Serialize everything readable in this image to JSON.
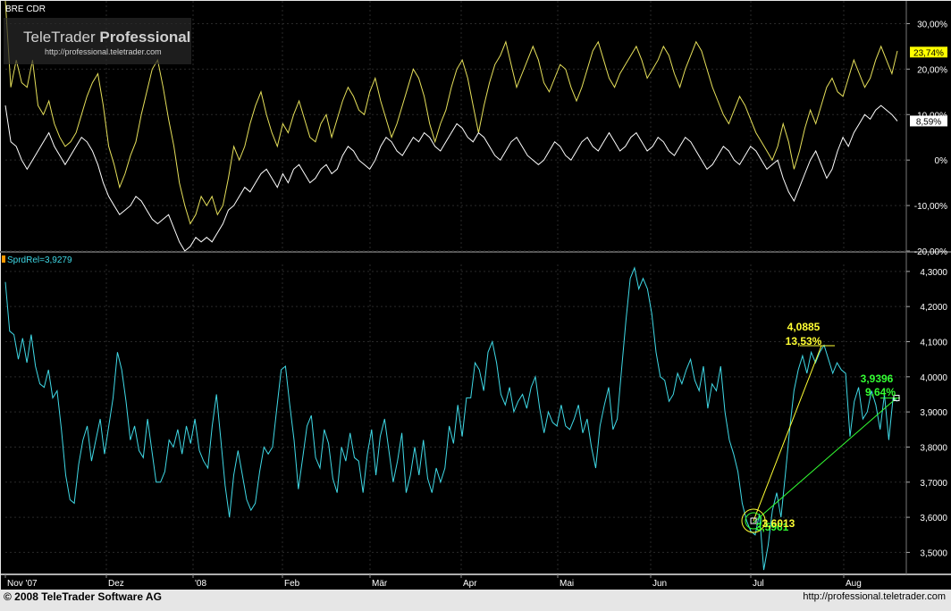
{
  "watermark": {
    "brand_light": "TeleTrader",
    "brand_bold": "Professional",
    "url": "http://professional.teletrader.com"
  },
  "top_panel": {
    "label": "BRE CDR"
  },
  "bottom_panel": {
    "label": "SprdRel=3,9279"
  },
  "footer": {
    "copyright": "© 2008 TeleTrader Software AG",
    "url": "http://professional.teletrader.com"
  },
  "colors": {
    "background": "#000000",
    "grid": "#2a2a2a",
    "yellow_series": "#e6e05a",
    "white_series": "#ffffff",
    "spread_series": "#3fd9e6",
    "annotation_yellow": "#ffff33",
    "annotation_green": "#33ff33",
    "top_tag_yellow": "#ffff00"
  },
  "chart_data": [
    {
      "type": "line",
      "title": "BRE CDR",
      "x": [
        "Nov '07",
        "Dez",
        "'08",
        "Feb",
        "Mär",
        "Apr",
        "Mai",
        "Jun",
        "Jul",
        "Aug"
      ],
      "ylim": [
        -20,
        35
      ],
      "y_ticks": [
        "30,00%",
        "20,00%",
        "10,00%",
        "0%",
        "-10,00%",
        "-20,00%"
      ],
      "series": [
        {
          "color": "yellow",
          "last_label": "23,74%",
          "last_value": 23.74,
          "values": [
            35,
            16,
            22,
            17,
            16,
            22,
            12,
            10,
            13,
            8,
            5,
            3,
            4,
            6,
            10,
            14,
            17,
            19,
            12,
            3,
            -1,
            -6,
            -3,
            1,
            4,
            10,
            15,
            20,
            22,
            16,
            9,
            3,
            -5,
            -10,
            -14,
            -12,
            -8,
            -10,
            -8,
            -12,
            -10,
            -4,
            3,
            0,
            3,
            8,
            12,
            15,
            10,
            6,
            3,
            8,
            6,
            10,
            13,
            9,
            5,
            4,
            8,
            10,
            5,
            9,
            13,
            16,
            14,
            11,
            10,
            15,
            18,
            13,
            9,
            5,
            8,
            12,
            16,
            20,
            18,
            14,
            8,
            4,
            8,
            11,
            16,
            20,
            22,
            18,
            12,
            6,
            12,
            17,
            21,
            23,
            26,
            21,
            16,
            19,
            22,
            25,
            22,
            17,
            15,
            18,
            21,
            20,
            16,
            13,
            16,
            20,
            24,
            26,
            22,
            18,
            16,
            19,
            21,
            23,
            25,
            22,
            18,
            20,
            22,
            25,
            23,
            19,
            16,
            20,
            23,
            26,
            24,
            20,
            16,
            13,
            10,
            8,
            11,
            14,
            12,
            9,
            6,
            4,
            2,
            0,
            3,
            8,
            4,
            -2,
            2,
            7,
            11,
            8,
            12,
            16,
            18,
            15,
            14,
            18,
            22,
            19,
            16,
            18,
            22,
            25,
            22,
            19,
            24
          ]
        },
        {
          "color": "white",
          "last_label": "8,59%",
          "last_value": 8.59,
          "values": [
            12,
            4,
            3,
            0,
            -2,
            0,
            2,
            4,
            6,
            3,
            1,
            -1,
            1,
            3,
            5,
            4,
            2,
            -1,
            -5,
            -8,
            -10,
            -12,
            -11,
            -10,
            -8,
            -9,
            -11,
            -13,
            -14,
            -13,
            -12,
            -15,
            -18,
            -20,
            -19,
            -17,
            -18,
            -17,
            -18,
            -16,
            -14,
            -11,
            -10,
            -8,
            -6,
            -7,
            -5,
            -3,
            -2,
            -4,
            -6,
            -3,
            -5,
            -2,
            -1,
            -3,
            -5,
            -4,
            -2,
            -1,
            -3,
            -2,
            1,
            3,
            2,
            0,
            -1,
            -2,
            0,
            3,
            5,
            4,
            2,
            1,
            3,
            5,
            4,
            6,
            5,
            3,
            2,
            4,
            6,
            8,
            7,
            5,
            4,
            6,
            5,
            3,
            1,
            0,
            2,
            4,
            5,
            3,
            1,
            0,
            -1,
            0,
            2,
            4,
            3,
            1,
            0,
            2,
            4,
            5,
            3,
            2,
            4,
            6,
            4,
            2,
            3,
            5,
            6,
            4,
            2,
            3,
            5,
            4,
            2,
            1,
            3,
            5,
            4,
            2,
            0,
            -2,
            -1,
            1,
            3,
            2,
            0,
            -1,
            1,
            3,
            2,
            0,
            -2,
            -1,
            0,
            -4,
            -7,
            -9,
            -6,
            -3,
            0,
            2,
            -1,
            -4,
            -2,
            2,
            5,
            3,
            6,
            8,
            10,
            9,
            11,
            12,
            11,
            10,
            8.59
          ]
        }
      ]
    },
    {
      "type": "line",
      "title": "SprdRel=3,9279",
      "x": [
        "Nov '07",
        "Dez",
        "'08",
        "Feb",
        "Mär",
        "Apr",
        "Mai",
        "Jun",
        "Jul",
        "Aug"
      ],
      "ylim": [
        3.44,
        4.32
      ],
      "y_ticks": [
        "4,3000",
        "4,2000",
        "4,1000",
        "4,0000",
        "3,9000",
        "3,8000",
        "3,7000",
        "3,6000",
        "3,5000"
      ],
      "series": [
        {
          "color": "cyan",
          "values": [
            4.27,
            4.13,
            4.12,
            4.05,
            4.11,
            4.04,
            4.12,
            4.03,
            3.98,
            3.97,
            4.02,
            3.94,
            3.96,
            3.85,
            3.72,
            3.65,
            3.64,
            3.75,
            3.82,
            3.86,
            3.76,
            3.82,
            3.88,
            3.78,
            3.86,
            3.94,
            4.07,
            4.02,
            3.93,
            3.82,
            3.86,
            3.79,
            3.77,
            3.88,
            3.79,
            3.7,
            3.7,
            3.73,
            3.82,
            3.8,
            3.85,
            3.78,
            3.86,
            3.81,
            3.88,
            3.79,
            3.76,
            3.74,
            3.86,
            3.95,
            3.82,
            3.69,
            3.6,
            3.72,
            3.79,
            3.72,
            3.65,
            3.62,
            3.64,
            3.73,
            3.8,
            3.78,
            3.8,
            3.91,
            4.02,
            4.03,
            3.92,
            3.82,
            3.68,
            3.77,
            3.86,
            3.89,
            3.77,
            3.74,
            3.85,
            3.81,
            3.71,
            3.67,
            3.8,
            3.76,
            3.84,
            3.77,
            3.76,
            3.67,
            3.78,
            3.85,
            3.72,
            3.83,
            3.88,
            3.79,
            3.7,
            3.76,
            3.84,
            3.67,
            3.72,
            3.8,
            3.72,
            3.82,
            3.71,
            3.67,
            3.74,
            3.7,
            3.74,
            3.86,
            3.81,
            3.92,
            3.83,
            3.94,
            3.94,
            4.04,
            4.02,
            3.96,
            4.07,
            4.1,
            4.04,
            3.95,
            3.92,
            3.97,
            3.9,
            3.93,
            3.95,
            3.91,
            3.97,
            4.0,
            3.91,
            3.84,
            3.9,
            3.87,
            3.86,
            3.92,
            3.86,
            3.85,
            3.88,
            3.92,
            3.84,
            3.88,
            3.8,
            3.74,
            3.86,
            3.92,
            3.97,
            3.85,
            3.88,
            4.02,
            4.16,
            4.28,
            4.31,
            4.25,
            4.28,
            4.25,
            4.18,
            4.07,
            4.0,
            3.99,
            3.93,
            3.95,
            4.01,
            3.98,
            4.02,
            4.05,
            3.99,
            3.96,
            4.03,
            3.91,
            3.98,
            3.96,
            4.03,
            3.9,
            3.82,
            3.78,
            3.73,
            3.64,
            3.59,
            3.56,
            3.55,
            3.61,
            3.45,
            3.52,
            3.62,
            3.67,
            3.6,
            3.72,
            3.85,
            3.96,
            4.02,
            4.06,
            4.01,
            4.07,
            4.04,
            4.07,
            4.09,
            4.05,
            4.01,
            4.04,
            4.02,
            4.01,
            3.83,
            3.93,
            3.97,
            3.88,
            3.9,
            3.96,
            3.92,
            3.85,
            3.95,
            3.82,
            3.94,
            3.93
          ]
        }
      ],
      "annotations": [
        {
          "label": "4,0885",
          "label2": "13,53%",
          "color": "yellow"
        },
        {
          "label": "3,9396",
          "label2": "9,64%",
          "color": "green"
        },
        {
          "label": "3,6013",
          "color": "yellow"
        },
        {
          "label": "3,5961",
          "color": "green"
        }
      ]
    }
  ]
}
